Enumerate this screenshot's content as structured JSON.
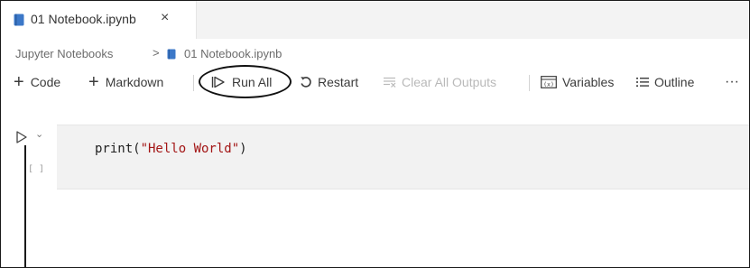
{
  "tabs": [
    {
      "label": "01 Notebook.ipynb",
      "icon": "notebook-icon",
      "close_glyph": "×"
    }
  ],
  "breadcrumb": {
    "root": "Jupyter Notebooks",
    "separator": ">",
    "file_icon": "notebook-icon",
    "file": "01 Notebook.ipynb"
  },
  "toolbar": {
    "code_label": "Code",
    "markdown_label": "Markdown",
    "run_all_label": "Run All",
    "restart_label": "Restart",
    "clear_outputs_label": "Clear All Outputs",
    "variables_label": "Variables",
    "outline_label": "Outline",
    "more_glyph": "···"
  },
  "cell": {
    "execution_count": "[ ]",
    "code_prefix": "print(",
    "code_string": "\"Hello World\"",
    "code_suffix": ")"
  },
  "colors": {
    "accent_icon": "#3c78c8",
    "cell_background": "#f2f2f2",
    "string": "#a31515"
  }
}
